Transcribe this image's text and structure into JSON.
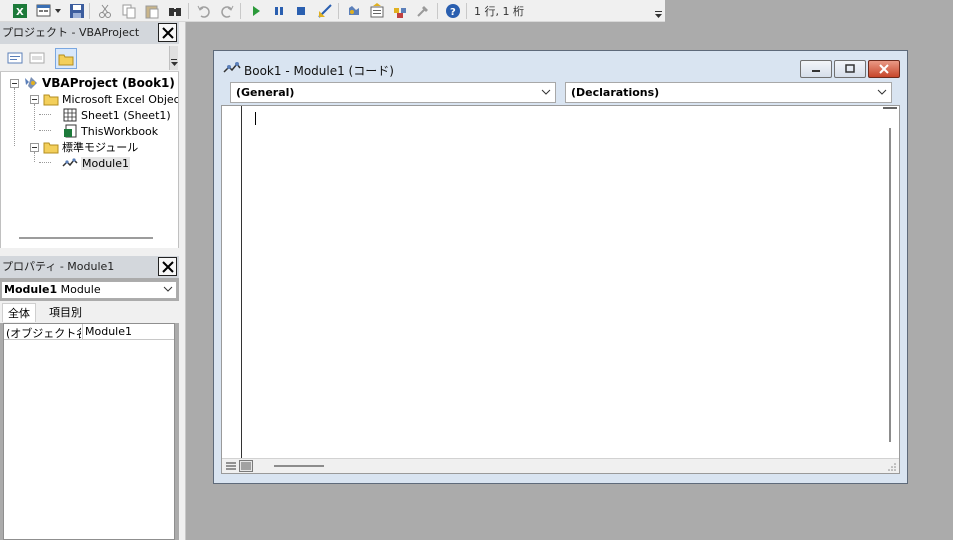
{
  "toolbar": {
    "position_text": "1 行, 1 桁",
    "icons": [
      "excel-icon",
      "insert-userform-icon",
      "dropdown-icon",
      "save-icon",
      "cut-icon",
      "copy-icon",
      "paste-icon",
      "find-icon",
      "undo-icon",
      "redo-icon",
      "run-icon",
      "break-icon",
      "reset-icon",
      "design-mode-icon",
      "project-explorer-icon",
      "properties-window-icon",
      "object-browser-icon",
      "toolbox-icon",
      "help-icon"
    ]
  },
  "project_panel": {
    "title": "プロジェクト - VBAProject",
    "tree": {
      "root": "VBAProject (Book1)",
      "folder_excel": "Microsoft Excel Objects",
      "sheet1": "Sheet1 (Sheet1)",
      "thisworkbook": "ThisWorkbook",
      "folder_modules": "標準モジュール",
      "module1": "Module1"
    }
  },
  "properties_panel": {
    "title": "プロパティ - Module1",
    "object_name": "Module1",
    "object_type": "Module",
    "tabs": [
      "全体",
      "項目別"
    ],
    "active_tab": 0,
    "rows": [
      {
        "name": "(オブジェクト名)",
        "value": "Module1"
      }
    ]
  },
  "code_window": {
    "title": "Book1 - Module1 (コード)",
    "object_combo": "(General)",
    "procedure_combo": "(Declarations)"
  },
  "colors": {
    "workspace": "#ababab",
    "window_frame": "#d9e4f1",
    "close_button": "#c7462b"
  }
}
